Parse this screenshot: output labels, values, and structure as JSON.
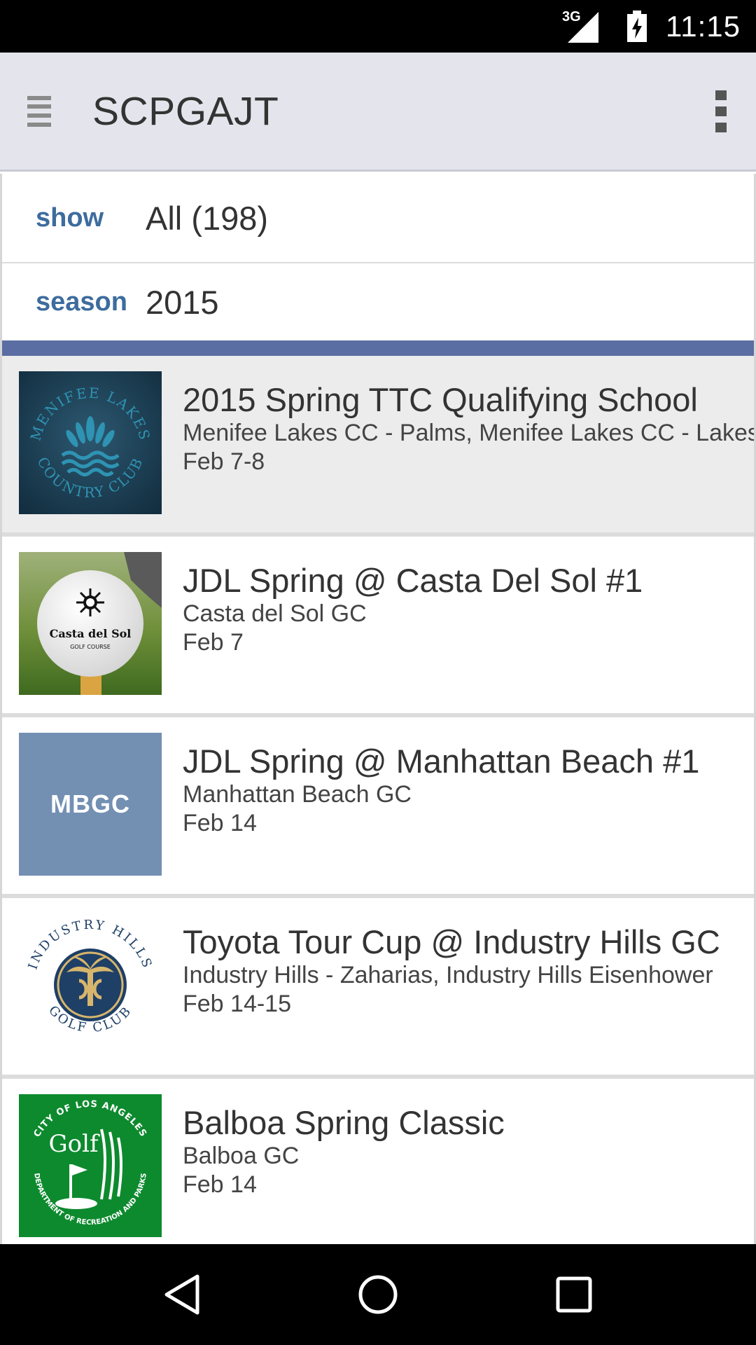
{
  "status_bar": {
    "network_label": "3G",
    "time": "11:15"
  },
  "app_bar": {
    "title": "SCPGAJT",
    "menu_icon": "hamburger-menu-icon",
    "overflow_icon": "more-vert-icon"
  },
  "filters": {
    "show": {
      "label": "show",
      "value": "All (198)"
    },
    "season": {
      "label": "season",
      "value": "2015"
    }
  },
  "events": [
    {
      "name": "2015 Spring TTC Qualifying School",
      "venue": "Menifee Lakes CC - Palms, Menifee Lakes CC - Lakes",
      "date": "Feb 7-8",
      "logo": "menifee-lakes-logo",
      "logo_text": "MENIFEE LAKES COUNTRY CLUB",
      "selected": true
    },
    {
      "name": "JDL Spring @ Casta Del Sol #1",
      "venue": "Casta del Sol GC",
      "date": "Feb 7",
      "logo": "casta-del-sol-logo",
      "logo_text_1": "Casta del Sol",
      "logo_text_2": "GOLF COURSE"
    },
    {
      "name": "JDL Spring @ Manhattan Beach #1",
      "venue": "Manhattan Beach GC",
      "date": "Feb 14",
      "logo": "mbgc-logo",
      "logo_text": "MBGC"
    },
    {
      "name": "Toyota Tour Cup @ Industry Hills GC",
      "venue": "Industry Hills - Zaharias, Industry Hills Eisenhower",
      "date": "Feb 14-15",
      "logo": "industry-hills-logo",
      "logo_text": "INDUSTRY HILLS GOLF CLUB"
    },
    {
      "name": "Balboa Spring Classic",
      "venue": "Balboa GC",
      "date": "Feb 14",
      "logo": "la-parks-golf-logo",
      "logo_text_1": "Golf",
      "logo_text_2": "CITY OF LOS ANGELES DEPARTMENT OF RECREATION AND PARKS"
    }
  ],
  "nav_bar": {
    "back_icon": "back-triangle-icon",
    "home_icon": "home-circle-icon",
    "recents_icon": "recents-square-icon"
  },
  "colors": {
    "accent_label": "#3d6c9e",
    "divider_band": "#5b6ea3",
    "app_bar": "#e4e5ec",
    "mbgc_bg": "#7390b3"
  }
}
